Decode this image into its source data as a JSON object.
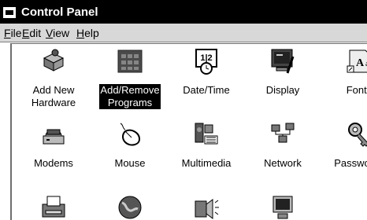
{
  "window": {
    "title": "Control Panel"
  },
  "menu": [
    {
      "mnemonic": "F",
      "rest": "ile"
    },
    {
      "mnemonic": "E",
      "rest": "dit"
    },
    {
      "mnemonic": "V",
      "rest": "iew"
    },
    {
      "mnemonic": "H",
      "rest": "elp"
    }
  ],
  "items": [
    {
      "label": "Add New\nHardware",
      "icon": "add-hardware-icon"
    },
    {
      "label": "Add/Remove\nPrograms",
      "icon": "add-remove-programs-icon",
      "selected": true
    },
    {
      "label": "Date/Time",
      "icon": "date-time-icon"
    },
    {
      "label": "Display",
      "icon": "display-icon"
    },
    {
      "label": "Fonts",
      "icon": "fonts-icon"
    },
    {
      "label": "Modems",
      "icon": "modem-icon"
    },
    {
      "label": "Mouse",
      "icon": "mouse-icon"
    },
    {
      "label": "Multimedia",
      "icon": "multimedia-icon"
    },
    {
      "label": "Network",
      "icon": "network-icon"
    },
    {
      "label": "Passwords",
      "icon": "passwords-icon"
    },
    {
      "label": "",
      "icon": "printer-icon"
    },
    {
      "label": "",
      "icon": "globe-icon"
    },
    {
      "label": "",
      "icon": "sounds-icon"
    },
    {
      "label": "",
      "icon": "computer-icon"
    }
  ]
}
